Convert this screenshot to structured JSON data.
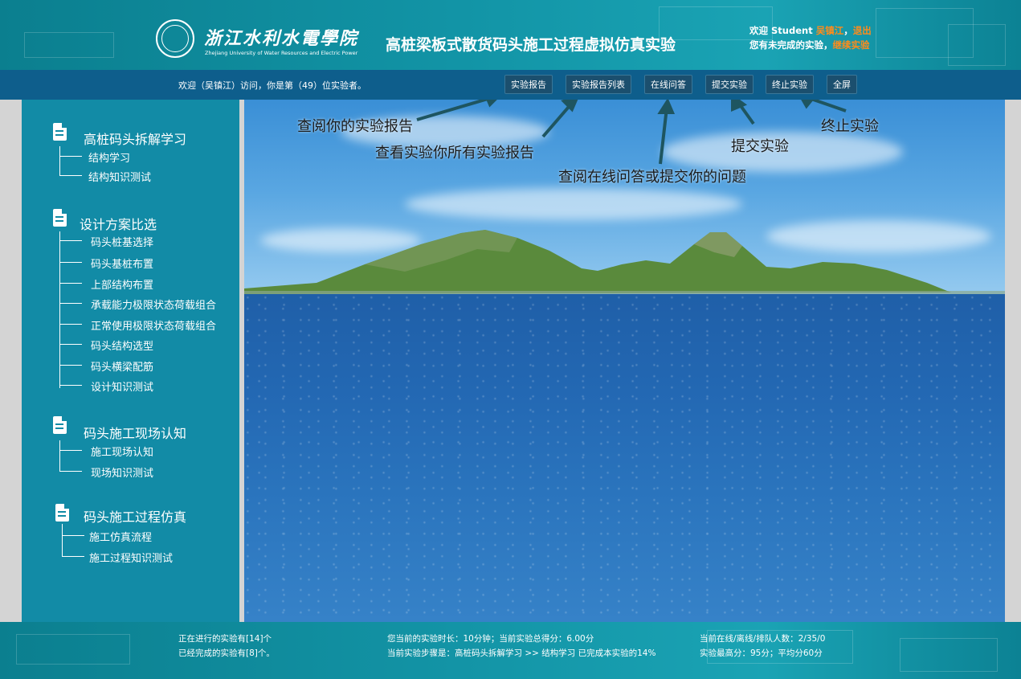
{
  "header": {
    "school_name_cn": "浙江水利水電學院",
    "school_name_en": "Zhejiang University of Water Resources and Electric Power",
    "app_title": "高桩梁板式散货码头施工过程虚拟仿真实验",
    "welcome_prefix": "欢迎 Student",
    "user_name": "吴镇江",
    "logout_label": "退出",
    "unfinished_text": "您有未完成的实验，",
    "continue_label": "继续实验"
  },
  "navbar": {
    "visitor_text": "欢迎（吴镇江）访问，你是第（49）位实验者。",
    "buttons": [
      {
        "label": "实验报告"
      },
      {
        "label": "实验报告列表"
      },
      {
        "label": "在线问答"
      },
      {
        "label": "提交实验"
      },
      {
        "label": "终止实验"
      },
      {
        "label": "全屏"
      }
    ]
  },
  "sidebar": {
    "sections": [
      {
        "title": "高桩码头拆解学习",
        "items": [
          "结构学习",
          "结构知识测试"
        ]
      },
      {
        "title": "设计方案比选",
        "items": [
          "码头桩基选择",
          "码头基桩布置",
          "上部结构布置",
          "承载能力极限状态荷载组合",
          "正常使用极限状态荷载组合",
          "码头结构选型",
          "码头横梁配筋",
          "设计知识测试"
        ]
      },
      {
        "title": "码头施工现场认知",
        "items": [
          "施工现场认知",
          "现场知识测试"
        ]
      },
      {
        "title": "码头施工过程仿真",
        "items": [
          "施工仿真流程",
          "施工过程知识测试"
        ]
      }
    ]
  },
  "annotations": {
    "report": "查阅你的实验报告",
    "report_list": "查看实验你所有实验报告",
    "qa": "查阅在线问答或提交你的问题",
    "submit": "提交实验",
    "terminate": "终止实验"
  },
  "footer": {
    "running": "正在进行的实验有[14]个",
    "completed": "已经完成的实验有[8]个。",
    "duration": "您当前的实验时长：10分钟；当前实验总得分：6.00分",
    "step": "当前实验步骤是：高桩码头拆解学习 >> 结构学习 已完成本实验的14%",
    "online": "当前在线/离线/排队人数：2/35/0",
    "scores": "实验最高分：95分；平均分60分"
  },
  "colors": {
    "header_bg": "#1294a6",
    "navbar_bg": "#0e5e8c",
    "sidebar_bg": "#128ba6",
    "accent_orange": "#ff8c1a"
  }
}
